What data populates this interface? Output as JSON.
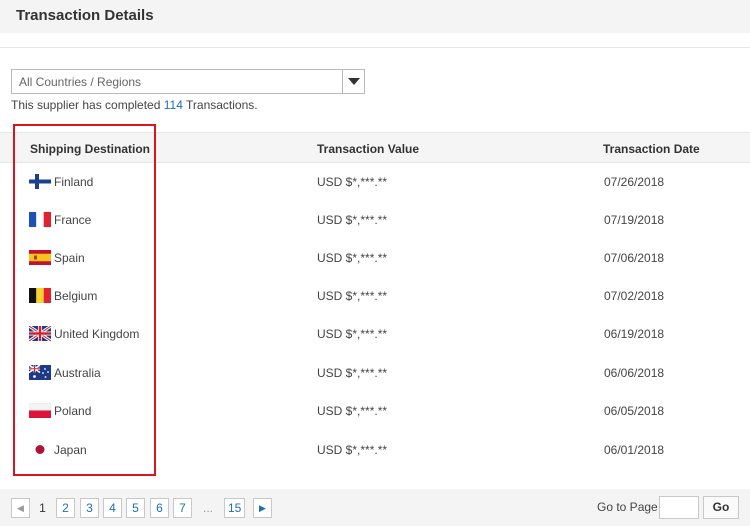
{
  "header": {
    "title": "Transaction Details"
  },
  "filter": {
    "selected": "All Countries / Regions"
  },
  "summary": {
    "prefix": "This supplier has completed ",
    "count": "114",
    "suffix": " Transactions."
  },
  "table": {
    "columns": [
      "Shipping Destination",
      "Transaction Value",
      "Transaction Date"
    ],
    "rows": [
      {
        "country": "Finland",
        "flag_icon": "finland-flag-icon",
        "value": "USD $*,***.**",
        "date": "07/26/2018"
      },
      {
        "country": "France",
        "flag_icon": "france-flag-icon",
        "value": "USD $*,***.**",
        "date": "07/19/2018"
      },
      {
        "country": "Spain",
        "flag_icon": "spain-flag-icon",
        "value": "USD $*,***.**",
        "date": "07/06/2018"
      },
      {
        "country": "Belgium",
        "flag_icon": "belgium-flag-icon",
        "value": "USD $*,***.**",
        "date": "07/02/2018"
      },
      {
        "country": "United Kingdom",
        "flag_icon": "uk-flag-icon",
        "value": "USD $*,***.**",
        "date": "06/19/2018"
      },
      {
        "country": "Australia",
        "flag_icon": "australia-flag-icon",
        "value": "USD $*,***.**",
        "date": "06/06/2018"
      },
      {
        "country": "Poland",
        "flag_icon": "poland-flag-icon",
        "value": "USD $*,***.**",
        "date": "06/05/2018"
      },
      {
        "country": "Japan",
        "flag_icon": "japan-flag-icon",
        "value": "USD $*,***.**",
        "date": "06/01/2018"
      }
    ]
  },
  "pagination": {
    "prev_icon": "chevron-left-icon",
    "next_icon": "chevron-right-icon",
    "pages": [
      "1",
      "2",
      "3",
      "4",
      "5",
      "6",
      "7"
    ],
    "current": "1",
    "ellipsis": "...",
    "last": "15",
    "goto_label": "Go to Page",
    "goto_value": "",
    "go_label": "Go"
  },
  "colors": {
    "link": "#1f6fb5",
    "highlight_border": "#d9151e",
    "header_bg": "#f5f5f5"
  }
}
